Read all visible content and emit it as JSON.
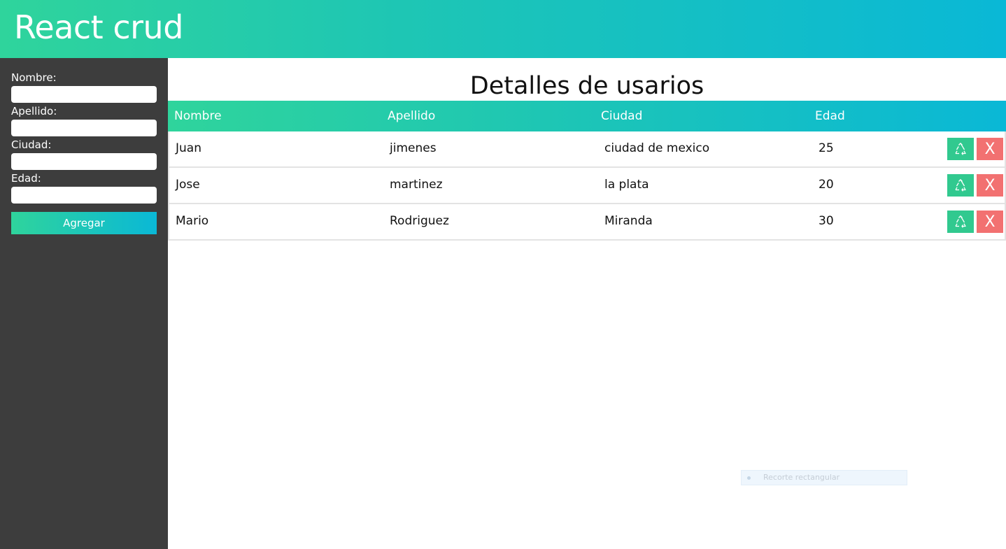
{
  "header": {
    "title": "React crud"
  },
  "form": {
    "fields": [
      {
        "label": "Nombre:",
        "value": "",
        "placeholder": ""
      },
      {
        "label": "Apellido:",
        "value": "",
        "placeholder": ""
      },
      {
        "label": "Ciudad:",
        "value": "",
        "placeholder": ""
      },
      {
        "label": "Edad:",
        "value": "",
        "placeholder": ""
      }
    ],
    "submit_label": "Agregar"
  },
  "main": {
    "title": "Detalles de usarios",
    "columns": [
      "Nombre",
      "Apellido",
      "Ciudad",
      "Edad"
    ],
    "rows": [
      {
        "nombre": "Juan",
        "apellido": "jimenes",
        "ciudad": "ciudad de mexico",
        "edad": "25",
        "edit_icon": "recycle-icon",
        "delete_label": "X"
      },
      {
        "nombre": "Jose",
        "apellido": "martinez",
        "ciudad": "la plata",
        "edad": "20",
        "edit_icon": "recycle-icon",
        "delete_label": "X"
      },
      {
        "nombre": "Mario",
        "apellido": "Rodriguez",
        "ciudad": "Miranda",
        "edad": "30",
        "edit_icon": "recycle-icon",
        "delete_label": "X"
      }
    ]
  },
  "overlay": {
    "tooltip_text": "Recorte rectangular"
  },
  "colors": {
    "gradient_start": "#2fd49c",
    "gradient_end": "#0ab8d6",
    "sidebar_bg": "#3d3d3d",
    "edit_button": "#31c98f",
    "delete_button": "#f27171"
  }
}
